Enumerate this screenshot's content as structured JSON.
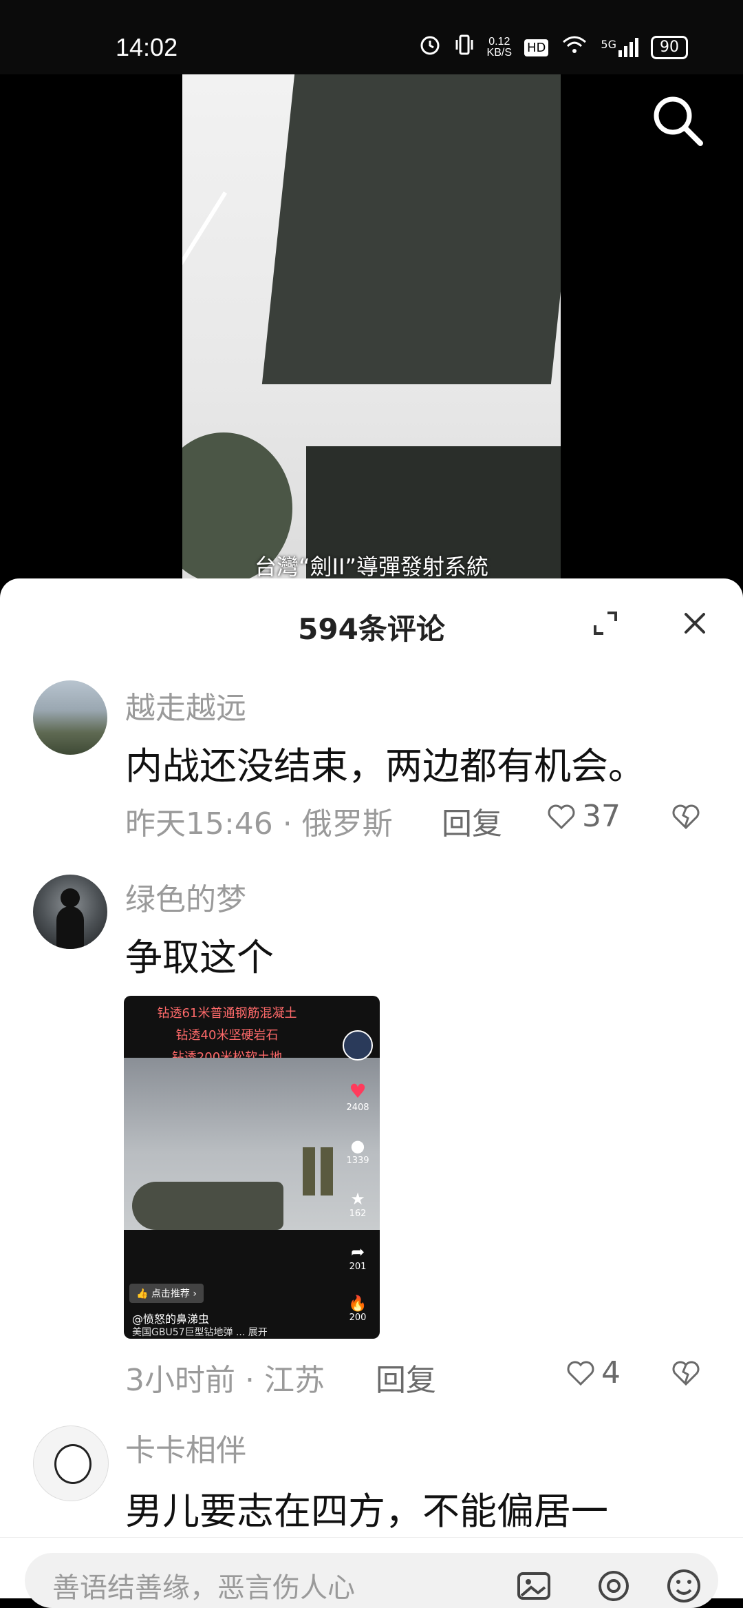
{
  "status_bar": {
    "time": "14:02",
    "net_speed_value": "0.12",
    "net_speed_unit": "KB/S",
    "hd": "HD",
    "signal": "5G",
    "battery": "90",
    "icons": [
      "alarm-icon",
      "vibrate-icon",
      "hd-icon",
      "wifi-icon",
      "signal-icon",
      "battery-icon"
    ]
  },
  "video": {
    "subtitle": "台灣“劍II”導彈發射系統",
    "icons": [
      "search-icon"
    ]
  },
  "sheet": {
    "title": "594条评论",
    "icons": [
      "expand-icon",
      "close-icon"
    ]
  },
  "comments": [
    {
      "username": "越走越远",
      "content": "内战还没结束，两边都有机会。",
      "meta": "昨天15:46 · 俄罗斯",
      "reply": "回复",
      "likes": "37"
    },
    {
      "username": "绿色的梦",
      "content": "争取这个",
      "meta": "3小时前 · 江苏",
      "reply": "回复",
      "likes": "4",
      "image": {
        "red_text": [
          "钻透61米普通钢筋混凝土",
          "钻透40米坚硬岩石",
          "钻透200米松软土地"
        ],
        "likes": "2408",
        "comments": "1339",
        "favorites": "162",
        "shares": "201",
        "extra": "200",
        "recommend": "点击推荐",
        "author": "@愤怒的鼻涕虫",
        "caption": "美国GBU57巨型钻地弹 ...  展开"
      }
    },
    {
      "username": "卡卡相伴",
      "content": "男儿要志在四方，不能偏居一"
    }
  ],
  "input": {
    "placeholder": "善语结善缘，恶言伤人心",
    "icons": [
      "image-icon",
      "at-icon",
      "emoji-icon"
    ]
  },
  "colors": {
    "sheet_bg": "#ffffff",
    "secondary_text": "#9a9a9a",
    "primary_text": "#111111"
  }
}
